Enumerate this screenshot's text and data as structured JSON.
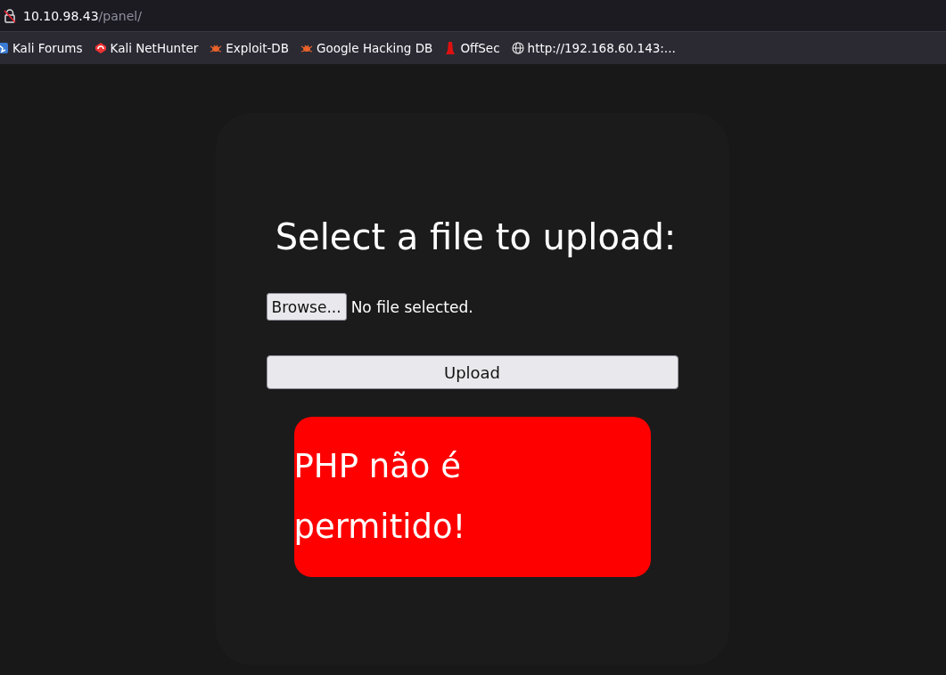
{
  "address_bar": {
    "host": "10.10.98.43",
    "path": "/panel/"
  },
  "bookmarks": [
    {
      "label": "Kali Forums",
      "kind": "kali-forums"
    },
    {
      "label": "Kali NetHunter",
      "kind": "nethunter"
    },
    {
      "label": "Exploit-DB",
      "kind": "bug"
    },
    {
      "label": "Google Hacking DB",
      "kind": "bug"
    },
    {
      "label": "OffSec",
      "kind": "offsec"
    },
    {
      "label": "http://192.168.60.143:...",
      "kind": "globe"
    }
  ],
  "upload_form": {
    "heading": "Select a file to upload:",
    "browse_button": "Browse...",
    "file_status": "No file selected.",
    "submit_button": "Upload"
  },
  "message": {
    "text": "PHP não é permitido!"
  }
}
